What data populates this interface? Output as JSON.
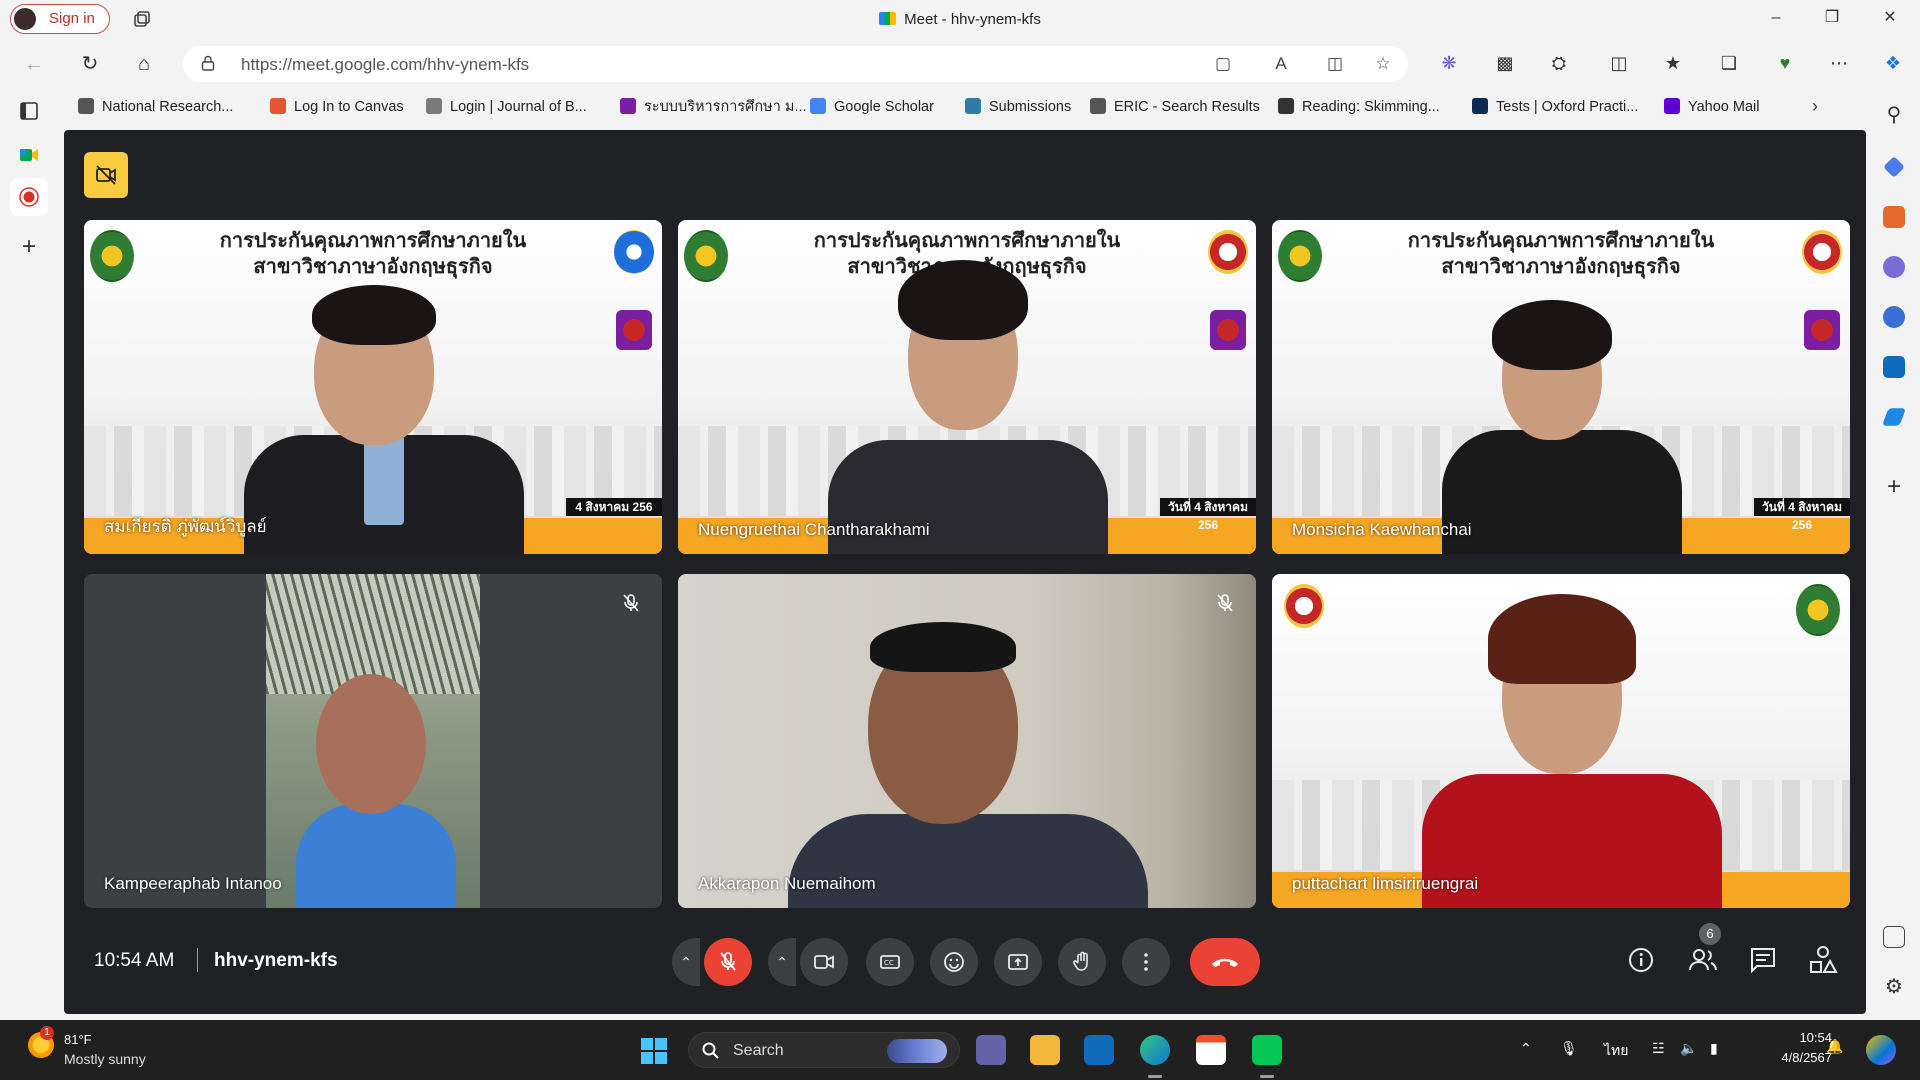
{
  "browser": {
    "signin_label": "Sign in",
    "window_title": "Meet - hhv-ynem-kfs",
    "url": "https://meet.google.com/hhv-ynem-kfs"
  },
  "favorites": [
    {
      "label": "National Research...",
      "color": "#555555"
    },
    {
      "label": "Log In to Canvas",
      "color": "#e4572e"
    },
    {
      "label": "Login | Journal of B...",
      "color": "#7a7a7a"
    },
    {
      "label": "ระบบบริหารการศึกษา ม...",
      "color": "#7b1fa2"
    },
    {
      "label": "Google Scholar",
      "color": "#4285f4"
    },
    {
      "label": "Submissions",
      "color": "#2e7da8"
    },
    {
      "label": "ERIC - Search Results",
      "color": "#555555"
    },
    {
      "label": "Reading: Skimming...",
      "color": "#333333"
    },
    {
      "label": "Tests | Oxford Practi...",
      "color": "#0d2a52"
    },
    {
      "label": "Yahoo Mail",
      "color": "#6001d2"
    }
  ],
  "meet": {
    "time": "10:54 AM",
    "code": "hhv-ynem-kfs",
    "participants_count": "6",
    "participants": [
      {
        "name": "สมเกียรติ ภู่พัฒน์วิบูลย์",
        "slide_title_1": "การประกันคุณภาพการศึกษาภายใน",
        "slide_title_2": "สาขาวิชาภาษาอังกฤษธุรกิจ",
        "date_tag": "4 สิงหาคม 256"
      },
      {
        "name": "Nuengruethai Chantharakhami",
        "slide_title_1": "การประกันคุณภาพการศึกษาภายใน",
        "slide_title_2": "สาขาวิชาภาษาอังกฤษธุรกิจ",
        "date_tag": "วันที่ 4 สิงหาคม 256"
      },
      {
        "name": "Monsicha Kaewhanchai",
        "slide_title_1": "การประกันคุณภาพการศึกษาภายใน",
        "slide_title_2": "สาขาวิชาภาษาอังกฤษธุรกิจ",
        "date_tag": "วันที่ 4 สิงหาคม 256"
      },
      {
        "name": "Kampeeraphab Intanoo",
        "muted": true
      },
      {
        "name": "Akkarapon Nuemaihom",
        "muted": true
      },
      {
        "name": "puttachart limsiriruengrai"
      }
    ]
  },
  "taskbar": {
    "weather_temp": "81°F",
    "weather_cond": "Mostly sunny",
    "weather_alert": "1",
    "search_label": "Search",
    "lang": "ไทย",
    "clock_time": "10:54",
    "clock_date": "4/8/2567"
  }
}
